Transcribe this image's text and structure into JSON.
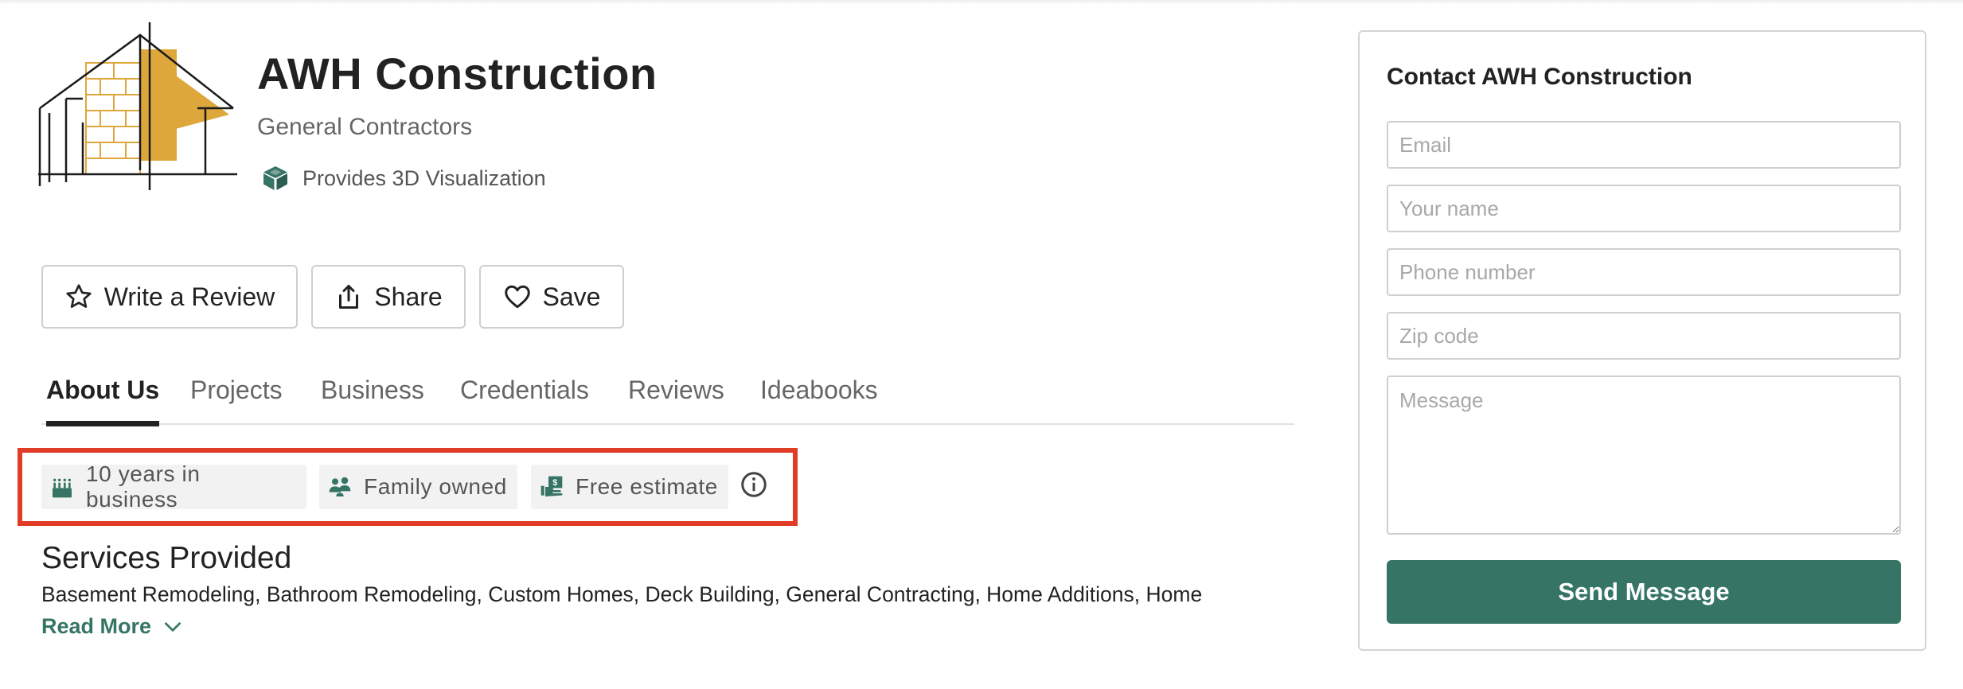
{
  "colors": {
    "accent": "#367565",
    "highlight": "#e03c26",
    "logo_gold": "#dda73b"
  },
  "business": {
    "name": "AWH Construction",
    "category": "General Contractors",
    "feature": "Provides 3D Visualization",
    "feature_icon": "cube-icon"
  },
  "actions": {
    "write_review": "Write a Review",
    "share": "Share",
    "save": "Save"
  },
  "tabs": [
    {
      "label": "About Us",
      "active": true
    },
    {
      "label": "Projects"
    },
    {
      "label": "Business"
    },
    {
      "label": "Credentials"
    },
    {
      "label": "Reviews"
    },
    {
      "label": "Ideabooks"
    }
  ],
  "badges": [
    {
      "label": "10 years in business",
      "icon": "cake-icon"
    },
    {
      "label": "Family owned",
      "icon": "family-icon"
    },
    {
      "label": "Free estimate",
      "icon": "estimate-icon"
    }
  ],
  "services": {
    "title": "Services Provided",
    "text": "Basement Remodeling, Bathroom Remodeling, Custom Homes, Deck Building, General Contracting, Home Additions, Home",
    "read_more": "Read More"
  },
  "contact": {
    "title": "Contact AWH Construction",
    "email_placeholder": "Email",
    "name_placeholder": "Your name",
    "phone_placeholder": "Phone number",
    "zip_placeholder": "Zip code",
    "message_placeholder": "Message",
    "send_label": "Send Message"
  }
}
